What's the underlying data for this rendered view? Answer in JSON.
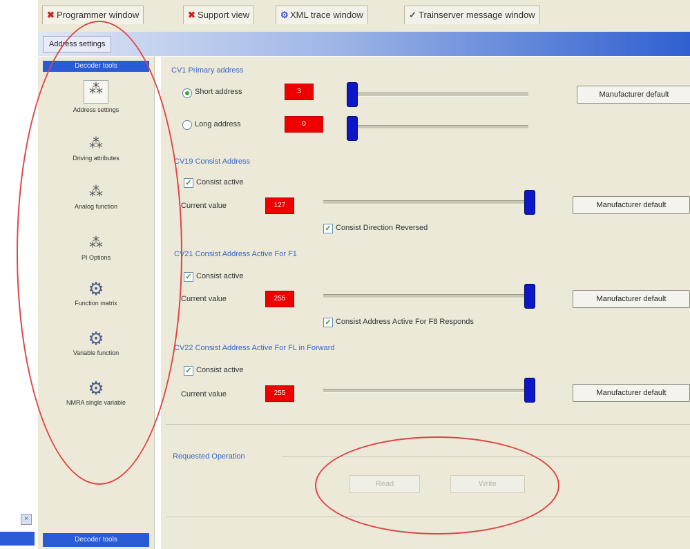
{
  "tabs": [
    {
      "label": "Programmer window",
      "icon": "close-icon"
    },
    {
      "label": "Support view",
      "icon": "close-icon"
    },
    {
      "label": "XML trace window",
      "icon": "gear-icon"
    },
    {
      "label": "Trainserver message window",
      "icon": "check-icon"
    }
  ],
  "settings_title": "Address settings",
  "sidebar": {
    "header": "Decoder tools",
    "footer": "Decoder tools",
    "items": [
      {
        "label": "Address settings",
        "icon": "decoder-icon"
      },
      {
        "label": "Driving attributes",
        "icon": "decoder-icon"
      },
      {
        "label": "Analog function",
        "icon": "decoder-icon"
      },
      {
        "label": "PI Options",
        "icon": "decoder-icon"
      },
      {
        "label": "Function matrix",
        "icon": "function-icon"
      },
      {
        "label": "Variable function",
        "icon": "function-icon"
      },
      {
        "label": "NMRA single variable",
        "icon": "function-icon"
      }
    ]
  },
  "primary_address": {
    "title": "CV1 Primary address",
    "short_label": "Short address",
    "short_value": "3",
    "short_selected": true,
    "long_label": "Long address",
    "long_value": "0",
    "long_selected": false,
    "short_slider": 0.0,
    "long_slider": 0.0,
    "default_button": "Manufacturer default"
  },
  "consist_address": {
    "title": "CV19 Consist Address",
    "enabled_label": "Consist active",
    "enabled": true,
    "value_label": "Current value",
    "value": "127",
    "slider": 1.0,
    "reversed_label": "Consist Direction Reversed",
    "reversed": true,
    "default_button": "Manufacturer default"
  },
  "consist_f1_f8": {
    "title": "CV21 Consist Address Active For F1",
    "enabled_label": "Consist active",
    "enabled": true,
    "value_label": "Current value",
    "value": "255",
    "slider": 1.0,
    "check_label": "Consist Address Active For F8 Responds",
    "checked": true,
    "default_button": "Manufacturer default"
  },
  "consist_fl": {
    "title": "CV22 Consist Address Active For FL in Forward",
    "enabled_label": "Consist active",
    "enabled": true,
    "value_label": "Current value",
    "value": "255",
    "slider": 1.0,
    "default_button": "Manufacturer default"
  },
  "requested_operation": {
    "title": "Requested Operation",
    "read_button": "Read",
    "write_button": "Write"
  },
  "colors": {
    "accent_blue": "#2a5bd7",
    "value_red": "#ee0000",
    "thumb_blue": "#0d17c8",
    "annotation_red": "#e04444",
    "panel_bg": "#ece9d8"
  }
}
